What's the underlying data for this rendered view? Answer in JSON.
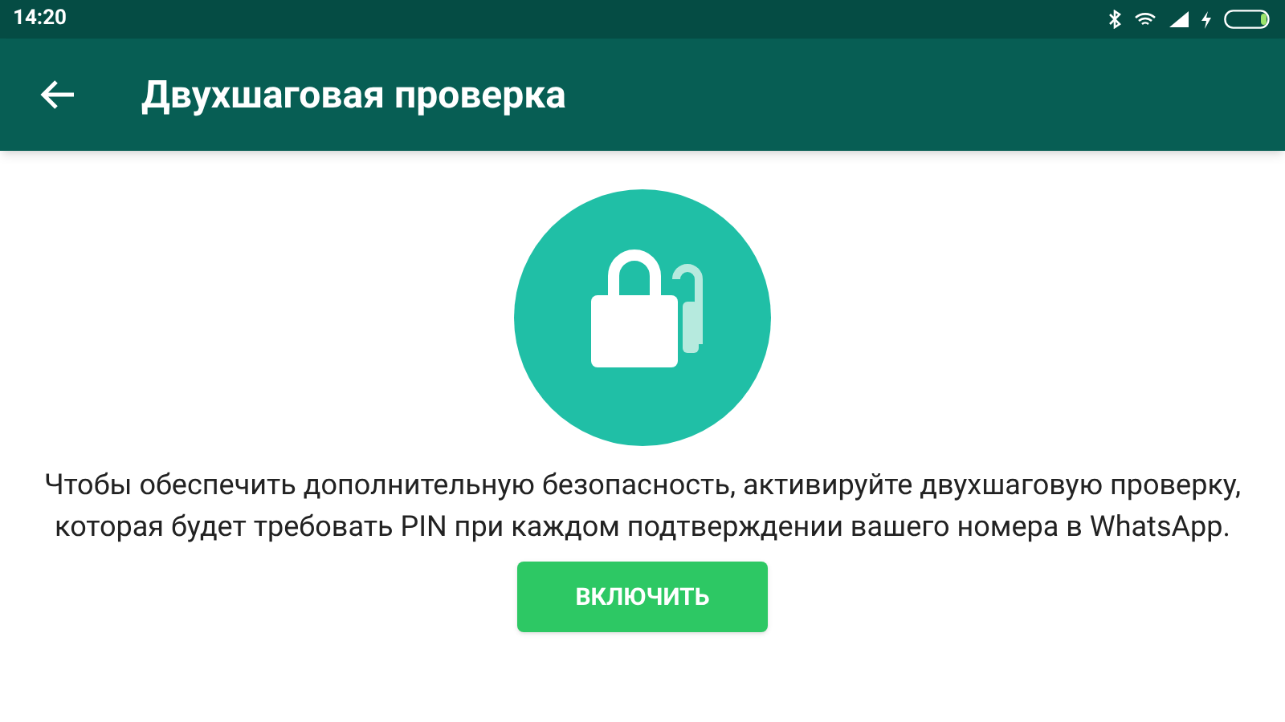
{
  "status_bar": {
    "time": "14:20"
  },
  "toolbar": {
    "title": "Двухшаговая проверка"
  },
  "description": "Чтобы обеспечить дополнительную безопасность, активируйте двухшаговую проверку, которая будет требовать PIN при каждом подтверждении вашего номера в WhatsApp.",
  "button": {
    "label": "ВКЛЮЧИТЬ"
  }
}
